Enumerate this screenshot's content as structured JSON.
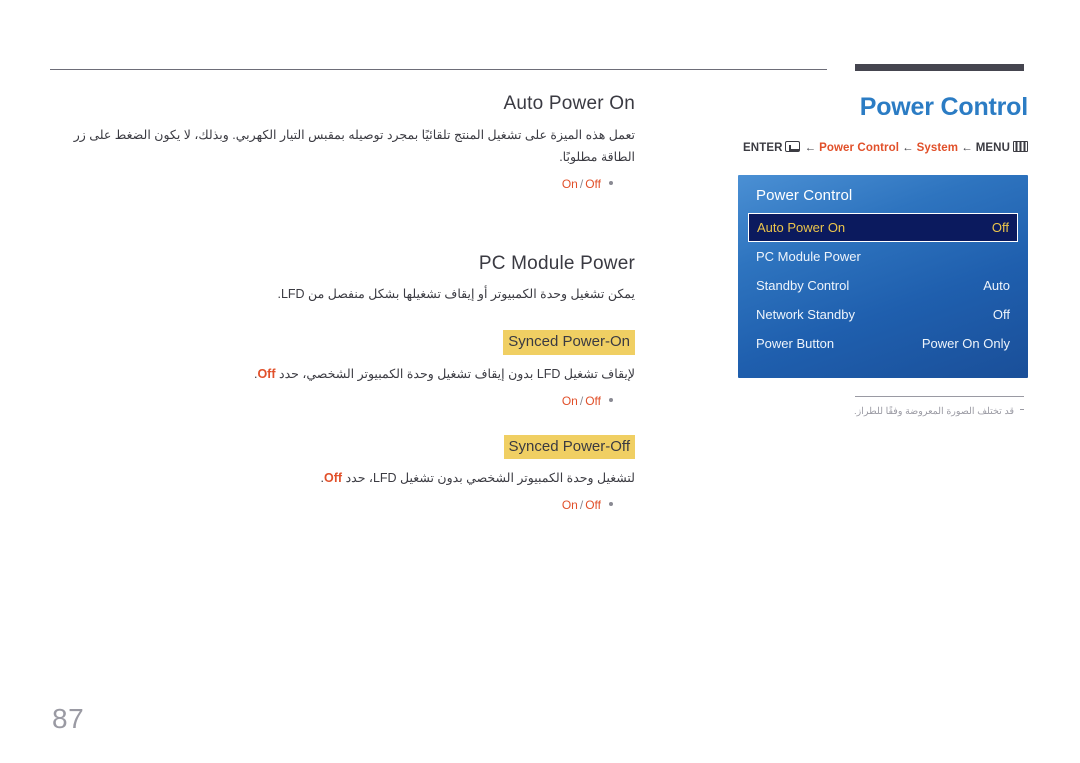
{
  "page": {
    "number": "87"
  },
  "right": {
    "title": "Power Control",
    "breadcrumb": {
      "enter_label": "ENTER",
      "enter_icon": "enter-key-icon",
      "arrow": "←",
      "crumb_1": "Power Control",
      "crumb_2": "System",
      "menu_label": "MENU",
      "menu_icon": "menu-grid-icon"
    },
    "note": "قد تختلف الصورة المعروضة وفقًا للطراز."
  },
  "osd": {
    "title": "Power Control",
    "rows": [
      {
        "label": "Auto Power On",
        "value": "Off",
        "selected": true
      },
      {
        "label": "PC Module Power",
        "value": "",
        "selected": false
      },
      {
        "label": "Standby Control",
        "value": "Auto",
        "selected": false
      },
      {
        "label": "Network Standby",
        "value": "Off",
        "selected": false
      },
      {
        "label": "Power Button",
        "value": "Power On Only",
        "selected": false
      }
    ]
  },
  "content": {
    "section1": {
      "heading": "Auto Power On",
      "paragraph": "تعمل هذه الميزة على تشغيل المنتج تلقائيًا بمجرد توصيله بمقبس التيار الكهربي. وبذلك، لا يكون الضغط على زر الطاقة مطلوبًا.",
      "option_on": "On",
      "option_sep": "/",
      "option_off": "Off"
    },
    "section2": {
      "heading": "PC Module Power",
      "paragraph": "يمكن تشغيل وحدة الكمبيوتر أو إيقاف تشغيلها بشكل منفصل من LFD.",
      "sub1": {
        "heading": "Synced Power-On",
        "paragraph_before": "لإيقاف تشغيل LFD بدون إيقاف تشغيل وحدة الكمبيوتر الشخصي، حدد",
        "paragraph_accent": "Off",
        "paragraph_after": ".",
        "option_on": "On",
        "option_sep": "/",
        "option_off": "Off"
      },
      "sub2": {
        "heading": "Synced Power-Off",
        "paragraph_before": "لتشغيل وحدة الكمبيوتر الشخصي بدون تشغيل LFD، حدد",
        "paragraph_accent": "Off",
        "paragraph_after": ".",
        "option_on": "On",
        "option_sep": "/",
        "option_off": "Off"
      }
    }
  },
  "colors": {
    "title_blue": "#2b7cc4",
    "accent_orange": "#e1502a",
    "highlight_yellow": "#f0cf63",
    "osd_selected_bg": "#0b1a5e",
    "osd_selected_text": "#ecc54b",
    "muted_gray": "#9a9aa3"
  }
}
